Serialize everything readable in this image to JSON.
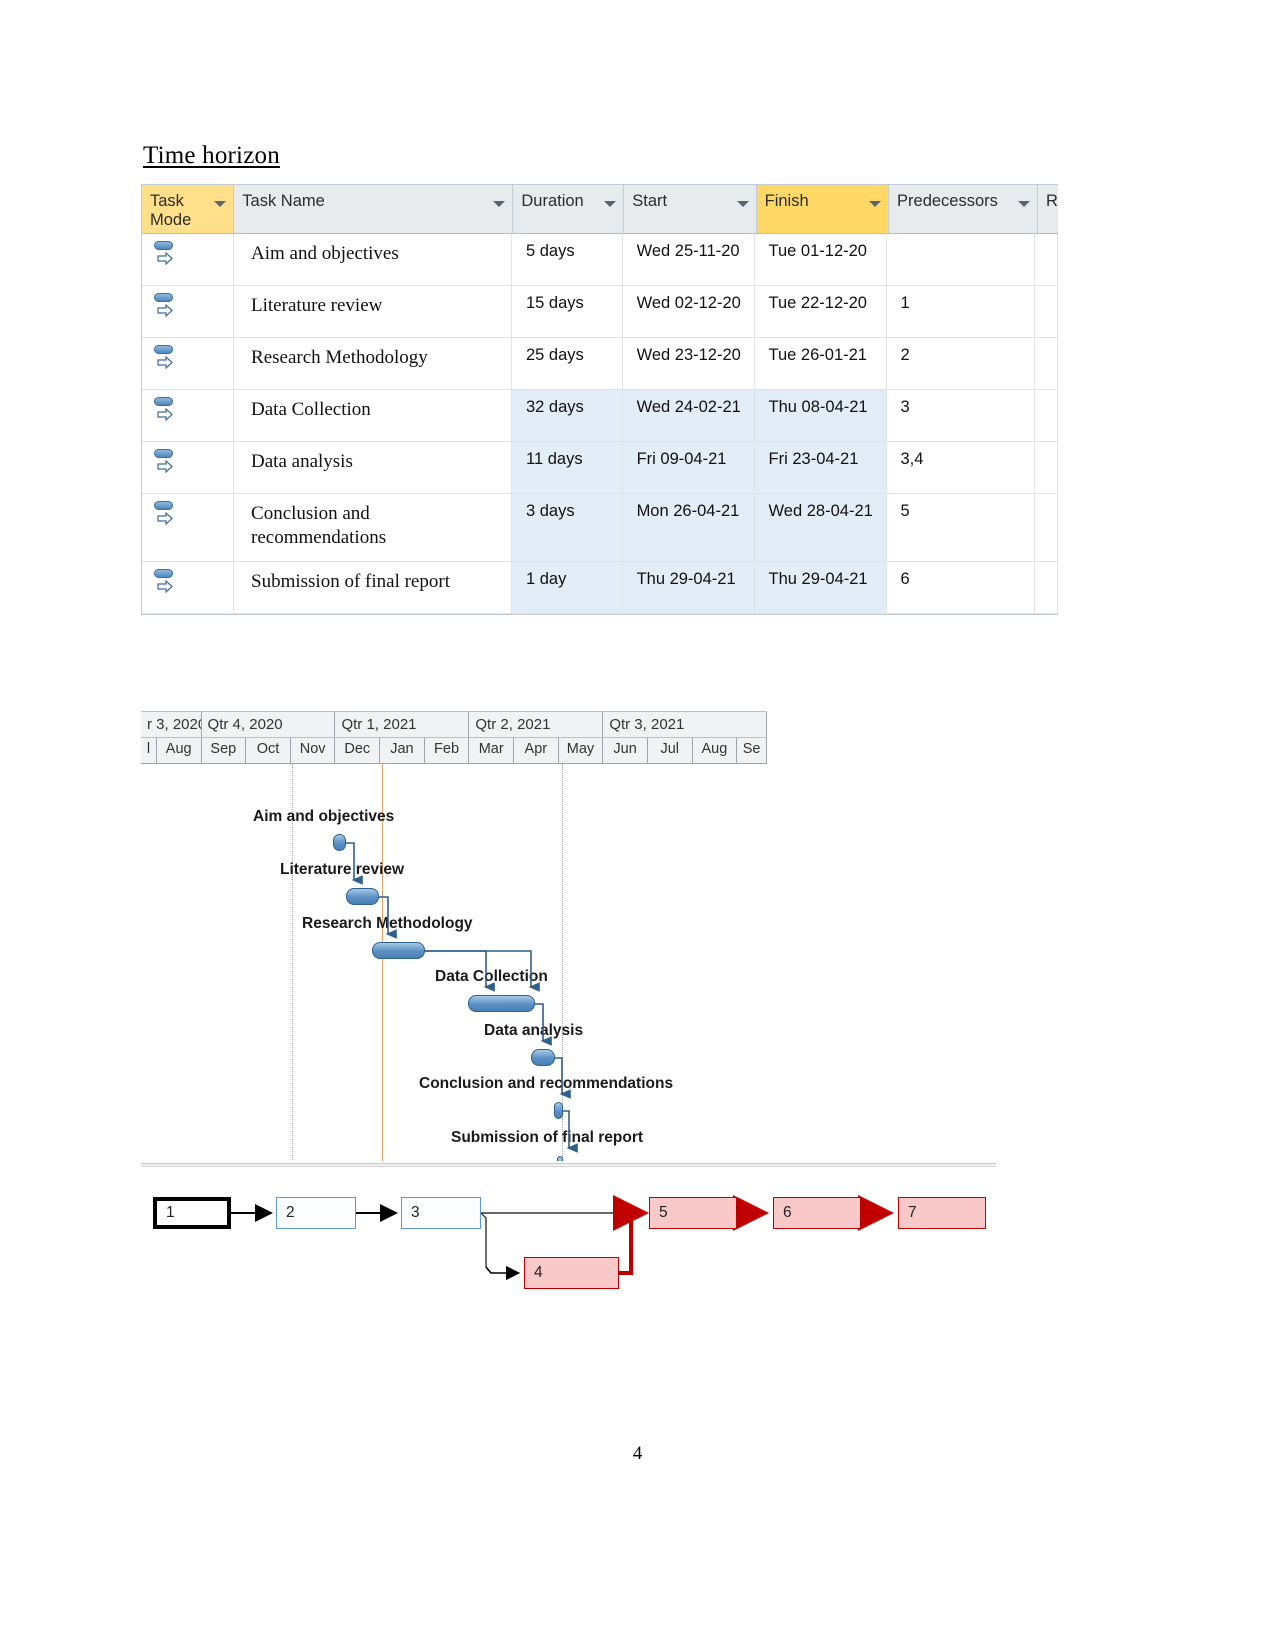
{
  "document": {
    "heading": "Time horizon",
    "page_number": "4"
  },
  "task_table": {
    "columns": [
      {
        "id": "task_mode",
        "label": "Task Mode",
        "highlight": "gold"
      },
      {
        "id": "task_name",
        "label": "Task Name",
        "highlight": "none"
      },
      {
        "id": "duration",
        "label": "Duration",
        "highlight": "none"
      },
      {
        "id": "start",
        "label": "Start",
        "highlight": "none"
      },
      {
        "id": "finish",
        "label": "Finish",
        "highlight": "gold"
      },
      {
        "id": "predecessors",
        "label": "Predecessors",
        "highlight": "none"
      },
      {
        "id": "resource_names",
        "label": "R",
        "highlight": "none"
      }
    ],
    "rows": [
      {
        "mode_icon": "auto-scheduled-icon",
        "name": "Aim and objectives",
        "duration": "5 days",
        "start": "Wed 25-11-20",
        "finish": "Tue 01-12-20",
        "predecessors": "",
        "highlighted": false
      },
      {
        "mode_icon": "auto-scheduled-icon",
        "name": "Literature review",
        "duration": "15 days",
        "start": "Wed 02-12-20",
        "finish": "Tue 22-12-20",
        "predecessors": "1",
        "highlighted": false
      },
      {
        "mode_icon": "auto-scheduled-icon",
        "name": "Research Methodology",
        "duration": "25 days",
        "start": "Wed 23-12-20",
        "finish": "Tue 26-01-21",
        "predecessors": "2",
        "highlighted": false
      },
      {
        "mode_icon": "auto-scheduled-icon",
        "name": "Data Collection",
        "duration": "32 days",
        "start": "Wed 24-02-21",
        "finish": "Thu 08-04-21",
        "predecessors": "3",
        "highlighted": true
      },
      {
        "mode_icon": "auto-scheduled-icon",
        "name": "Data analysis",
        "duration": "11 days",
        "start": "Fri 09-04-21",
        "finish": "Fri 23-04-21",
        "predecessors": "3,4",
        "highlighted": true
      },
      {
        "mode_icon": "auto-scheduled-icon",
        "name": "Conclusion and recommendations",
        "duration": "3 days",
        "start": "Mon 26-04-21",
        "finish": "Wed 28-04-21",
        "predecessors": "5",
        "highlighted": true
      },
      {
        "mode_icon": "auto-scheduled-icon",
        "name": "Submission of final report",
        "duration": "1 day",
        "start": "Thu 29-04-21",
        "finish": "Thu 29-04-21",
        "predecessors": "6",
        "highlighted": true
      }
    ]
  },
  "gantt": {
    "quarters": [
      "r 3, 2020",
      "Qtr 4, 2020",
      "Qtr 1, 2021",
      "Qtr 2, 2021",
      "Qtr 3, 2021"
    ],
    "months": [
      "l",
      "Aug",
      "Sep",
      "Oct",
      "Nov",
      "Dec",
      "Jan",
      "Feb",
      "Mar",
      "Apr",
      "May",
      "Jun",
      "Jul",
      "Aug",
      "Se"
    ],
    "today_marker_month": "Feb",
    "bars": [
      {
        "label": "Aim and objectives",
        "start_month": "Dec",
        "span_days": 5
      },
      {
        "label": "Literature review",
        "start_month": "Dec",
        "span_days": 15
      },
      {
        "label": "Research Methodology",
        "start_month": "Dec",
        "span_days": 25
      },
      {
        "label": "Data Collection",
        "start_month": "Feb",
        "span_days": 32
      },
      {
        "label": "Data analysis",
        "start_month": "Apr",
        "span_days": 11
      },
      {
        "label": "Conclusion and recommendations",
        "start_month": "Apr",
        "span_days": 3
      },
      {
        "label": "Submission of final report",
        "start_month": "Apr",
        "span_days": 1
      }
    ],
    "colors": {
      "bar_fill": "#5b90c4",
      "bar_border": "#2f5f8c",
      "today_line": "#e0a46a",
      "connector": "#2f5f8c"
    }
  },
  "network_diagram": {
    "nodes": [
      {
        "id": "1",
        "label": "1",
        "style": "start"
      },
      {
        "id": "2",
        "label": "2",
        "style": "normal"
      },
      {
        "id": "3",
        "label": "3",
        "style": "normal"
      },
      {
        "id": "4",
        "label": "4",
        "style": "critical"
      },
      {
        "id": "5",
        "label": "5",
        "style": "critical"
      },
      {
        "id": "6",
        "label": "6",
        "style": "critical"
      },
      {
        "id": "7",
        "label": "7",
        "style": "critical"
      }
    ],
    "edges": [
      {
        "from": "1",
        "to": "2",
        "critical": false
      },
      {
        "from": "2",
        "to": "3",
        "critical": false
      },
      {
        "from": "3",
        "to": "4",
        "critical": false
      },
      {
        "from": "3",
        "to": "5",
        "critical": false
      },
      {
        "from": "4",
        "to": "5",
        "critical": true
      },
      {
        "from": "5",
        "to": "6",
        "critical": true
      },
      {
        "from": "6",
        "to": "7",
        "critical": true
      }
    ],
    "colors": {
      "critical": "#c00000",
      "critical_fill": "#f9c9c9",
      "normal_border": "#5b9bd5",
      "start_border": "#000000"
    }
  }
}
